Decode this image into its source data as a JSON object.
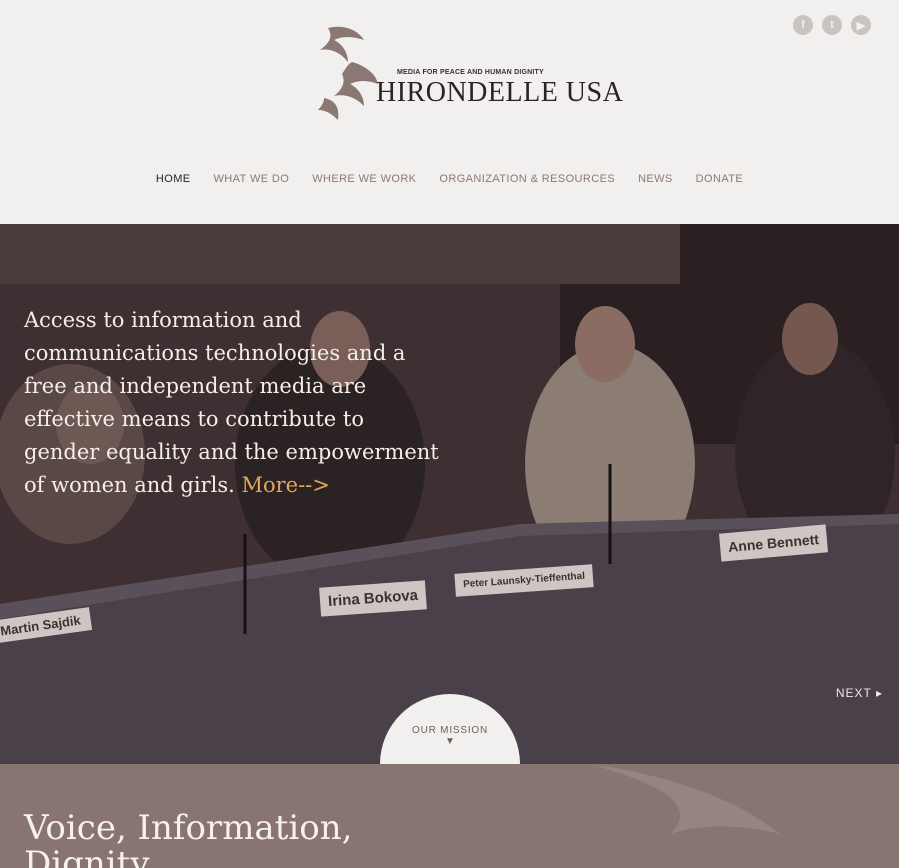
{
  "header": {
    "logo": {
      "tagline": "MEDIA FOR PEACE AND HUMAN DIGNITY",
      "name": "HIRONDELLE USA"
    },
    "social": [
      {
        "icon": "facebook-icon",
        "glyph": "f"
      },
      {
        "icon": "twitter-icon",
        "glyph": "t"
      },
      {
        "icon": "youtube-icon",
        "glyph": "▶"
      }
    ],
    "nav": [
      "HOME",
      "WHAT WE DO",
      "WHERE WE WORK",
      "ORGANIZATION & RESOURCES",
      "NEWS",
      "DONATE"
    ],
    "active_nav": "HOME"
  },
  "hero": {
    "text": "Access to information and communications technologies and a free and independent media are effective means to contribute to gender equality and the empowerment of women and girls.",
    "more_link": "More-->",
    "next_label": "NEXT ▸",
    "mission_label": "OUR MISSION",
    "mission_arrow": "▼",
    "nameplates": [
      "Martin Sajdik",
      "Irina Bokova",
      "Peter Launsky-Tieffenthal",
      "Anne Bennett"
    ]
  },
  "section": {
    "title": "Voice, Information, Dignity"
  },
  "colors": {
    "accent": "#e0a85f",
    "overlay": "#3d2f32",
    "band": "#887470"
  }
}
